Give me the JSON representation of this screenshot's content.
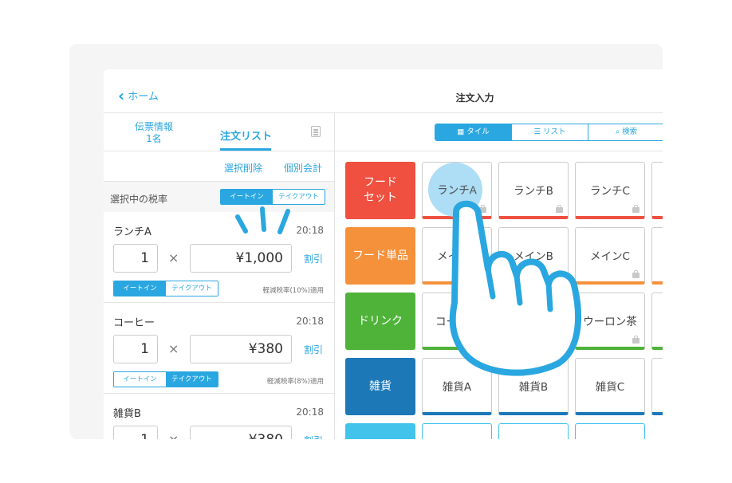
{
  "header": {
    "back_label": "ホーム",
    "title": "注文入力"
  },
  "left_tabs": {
    "slip_info": "伝票情報",
    "guests": "1名",
    "order_list": "注文リスト"
  },
  "actions": {
    "delete_selected": "選択削除",
    "separate_bill": "個別会計"
  },
  "tax": {
    "label": "選択中の税率",
    "eat_in": "イートイン",
    "take_out": "テイクアウト",
    "selected": "イートイン"
  },
  "items": [
    {
      "name": "ランチA",
      "time": "20:18",
      "qty": "1",
      "times": "×",
      "price": "¥1,000",
      "discount": "割引",
      "eat_in": "イートイン",
      "take_out": "テイクアウト",
      "rate": "軽減税率(10%)適用",
      "selected": "イートイン"
    },
    {
      "name": "コーヒー",
      "time": "20:18",
      "qty": "1",
      "times": "×",
      "price": "¥380",
      "discount": "割引",
      "eat_in": "イートイン",
      "take_out": "テイクアウト",
      "rate": "軽減税率(8%)適用",
      "selected": "テイクアウト"
    },
    {
      "name": "雑貨B",
      "time": "20:18",
      "qty": "1",
      "times": "×",
      "price": "¥380",
      "discount": "割引"
    }
  ],
  "view_modes": {
    "tile": "タイル",
    "list": "リスト",
    "search": "検索",
    "selected": "タイル"
  },
  "categories": [
    {
      "label": "フード\nセット",
      "color": "#ef5040"
    },
    {
      "label": "フード単品",
      "color": "#f5913b"
    },
    {
      "label": "ドリンク",
      "color": "#4fb33a"
    },
    {
      "label": "雑貨",
      "color": "#1d78b8"
    }
  ],
  "products": {
    "row1": [
      "ランチA",
      "ランチB",
      "ランチC"
    ],
    "row2": [
      "メインA",
      "メインB",
      "メインC"
    ],
    "row3": [
      "コーヒー",
      "紅茶",
      "ウーロン茶"
    ],
    "row4": [
      "雑貨A",
      "雑貨B",
      "雑貨C"
    ]
  },
  "colors": {
    "accent": "#2aa7e0",
    "food_set": "#ef5040",
    "food_single": "#f5913b",
    "drink": "#4fb33a",
    "goods": "#1d78b8"
  }
}
